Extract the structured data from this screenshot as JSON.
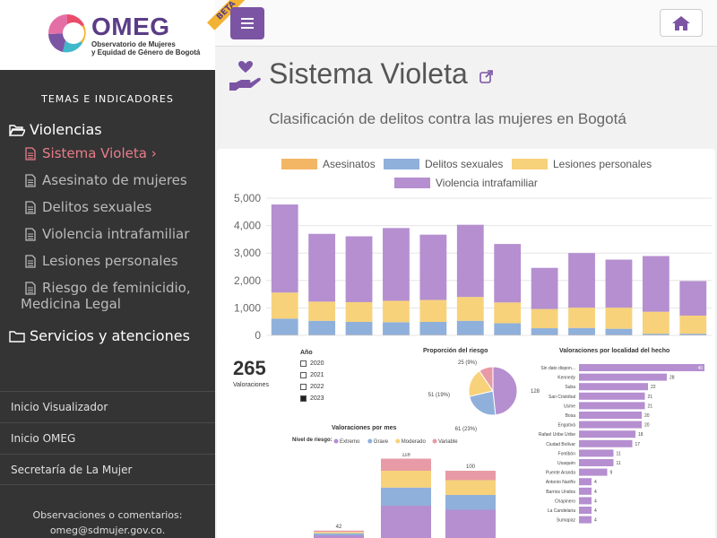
{
  "sidebar": {
    "logo_title": "OMEG",
    "logo_sub1": "Observatorio de Mujeres",
    "logo_sub2": "y Equidad de Género de Bogotá",
    "heading": "TEMAS E INDICADORES",
    "categories": [
      {
        "label": "Violencias",
        "icon": "folder-open-icon"
      },
      {
        "label": "Servicios y atenciones",
        "icon": "folder-icon"
      }
    ],
    "items": [
      {
        "label": "Sistema Violeta ›",
        "active": true
      },
      {
        "label": "Asesinato de mujeres"
      },
      {
        "label": "Delitos sexuales"
      },
      {
        "label": "Violencia intrafamiliar"
      },
      {
        "label": "Lesiones personales"
      },
      {
        "label": "Riesgo de feminicidio,",
        "label2": "Medicina Legal"
      }
    ],
    "links": [
      "Inicio Visualizador",
      "Inicio OMEG",
      "Secretaría de La Mujer"
    ],
    "feedback_line1": "Observaciones o comentarios:",
    "feedback_line2": "omeg@sdmujer.gov.co."
  },
  "topbar": {
    "beta": "BETA",
    "menu_icon": "hamburger-icon",
    "home_icon": "home-icon"
  },
  "page": {
    "title": "Sistema Violeta",
    "subtitle": "Clasificación de delitos contra las mujeres en Bogotá",
    "accent": "#7b54a3"
  },
  "chart_data": [
    {
      "type": "bar",
      "stacked": true,
      "legend": [
        "Asesinatos",
        "Delitos sexuales",
        "Lesiones personales",
        "Violencia intrafamiliar"
      ],
      "legend_position": "top",
      "colors": [
        "#f3b664",
        "#8fb0db",
        "#f7d27a",
        "#b58fd0"
      ],
      "y_ticks": [
        "5,000",
        "4,000",
        "3,000",
        "2,000",
        "1,000",
        "0"
      ],
      "ylim": [
        0,
        5000
      ],
      "grid": true,
      "series": [
        {
          "name": "Asesinatos",
          "values": [
            10,
            10,
            10,
            10,
            10,
            10,
            10,
            10,
            10,
            10,
            10,
            10
          ]
        },
        {
          "name": "Delitos sexuales",
          "values": [
            600,
            520,
            480,
            470,
            480,
            520,
            430,
            250,
            260,
            230,
            50,
            50
          ]
        },
        {
          "name": "Lesiones personales",
          "values": [
            950,
            700,
            720,
            780,
            800,
            870,
            760,
            700,
            740,
            770,
            800,
            660
          ]
        },
        {
          "name": "Violencia intrafamiliar",
          "values": [
            3210,
            2470,
            2400,
            2650,
            2380,
            2630,
            2130,
            1500,
            1990,
            1750,
            2030,
            1260
          ]
        }
      ]
    }
  ],
  "dashboard": {
    "count": "265",
    "count_label": "Valoraciones",
    "year_title": "Año",
    "years": [
      {
        "label": "2020",
        "checked": false
      },
      {
        "label": "2021",
        "checked": false
      },
      {
        "label": "2022",
        "checked": false
      },
      {
        "label": "2023",
        "checked": true
      }
    ],
    "pie_title": "Proporción del riesgo",
    "pie": {
      "type": "pie",
      "slices": [
        {
          "label": "128 (48%)",
          "value": 128,
          "color": "#b58fd0"
        },
        {
          "label": "61 (23%)",
          "value": 61,
          "color": "#8fb0db"
        },
        {
          "label": "51 (19%)",
          "value": 51,
          "color": "#f7d27a"
        },
        {
          "label": "25 (9%)",
          "value": 25,
          "color": "#e89aa6"
        }
      ]
    },
    "locality_title": "Valoraciones por localidad del hecho",
    "localities": [
      {
        "name": "Sin dato dispon...",
        "value": 40
      },
      {
        "name": "Kennedy",
        "value": 28
      },
      {
        "name": "Suba",
        "value": 22
      },
      {
        "name": "San Cristóbal",
        "value": 21
      },
      {
        "name": "Usme",
        "value": 21
      },
      {
        "name": "Bosa",
        "value": 20
      },
      {
        "name": "Engativá",
        "value": 20
      },
      {
        "name": "Rafael Uribe Uribe",
        "value": 18
      },
      {
        "name": "Ciudad Bolívar",
        "value": 17
      },
      {
        "name": "Fontibón",
        "value": 11
      },
      {
        "name": "Usaquén",
        "value": 11
      },
      {
        "name": "Puente Aranda",
        "value": 9
      },
      {
        "name": "Antonio Nariño",
        "value": 4
      },
      {
        "name": "Barrios Unidos",
        "value": 4
      },
      {
        "name": "Chapinero",
        "value": 4
      },
      {
        "name": "La Candelaria",
        "value": 4
      },
      {
        "name": "Sumapaz",
        "value": 4
      }
    ],
    "month_title": "Valoraciones por mes",
    "month_legend_title": "Nivel de riesgo:",
    "month_legend": [
      {
        "label": "Extremo",
        "color": "#b58fd0"
      },
      {
        "label": "Grave",
        "color": "#8fb0db"
      },
      {
        "label": "Moderado",
        "color": "#f7d27a"
      },
      {
        "label": "Variable",
        "color": "#e89aa6"
      }
    ],
    "month_bars": [
      {
        "total": "42",
        "segments": [
          4,
          3,
          2,
          2
        ]
      },
      {
        "total": "118",
        "segments": [
          48,
          27,
          25,
          18
        ]
      },
      {
        "total": "100",
        "segments": [
          42,
          22,
          22,
          14
        ]
      }
    ]
  }
}
